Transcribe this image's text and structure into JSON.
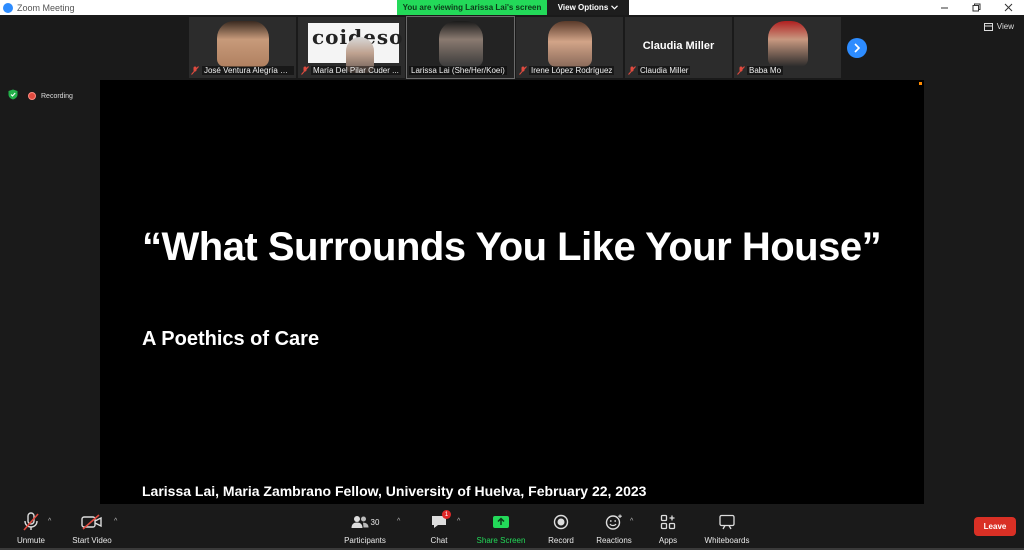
{
  "window": {
    "title": "Zoom Meeting",
    "share_banner": "You are viewing Larissa Lai's screen",
    "view_options": "View Options"
  },
  "gallery": {
    "view_label": "View",
    "participants": [
      {
        "name": "José Ventura Alegría H...",
        "muted": true
      },
      {
        "name": "María Del Pilar Cuder ...",
        "muted": true,
        "logo": "coideso"
      },
      {
        "name": "Larissa Lai (She/Her/Koei)",
        "muted": false
      },
      {
        "name": "Irene López Rodríguez",
        "muted": true
      },
      {
        "name": "Claudia Miller",
        "muted": true,
        "video_off_label": "Claudia Miller"
      },
      {
        "name": "Baba Mo",
        "muted": true
      }
    ]
  },
  "status": {
    "recording_label": "Recording"
  },
  "slide": {
    "title": "“What Surrounds You Like Your House”",
    "subtitle": "A Poethics of Care",
    "footer": "Larissa Lai, Maria Zambrano Fellow, University of Huelva, February 22, 2023"
  },
  "toolbar": {
    "unmute": "Unmute",
    "start_video": "Start Video",
    "participants": "Participants",
    "participants_count": "30",
    "chat": "Chat",
    "chat_badge": "1",
    "share_screen": "Share Screen",
    "record": "Record",
    "reactions": "Reactions",
    "apps": "Apps",
    "whiteboards": "Whiteboards",
    "leave": "Leave"
  },
  "colors": {
    "accent": "#2d8cff",
    "share_green": "#23d959",
    "leave_red": "#d93025"
  }
}
